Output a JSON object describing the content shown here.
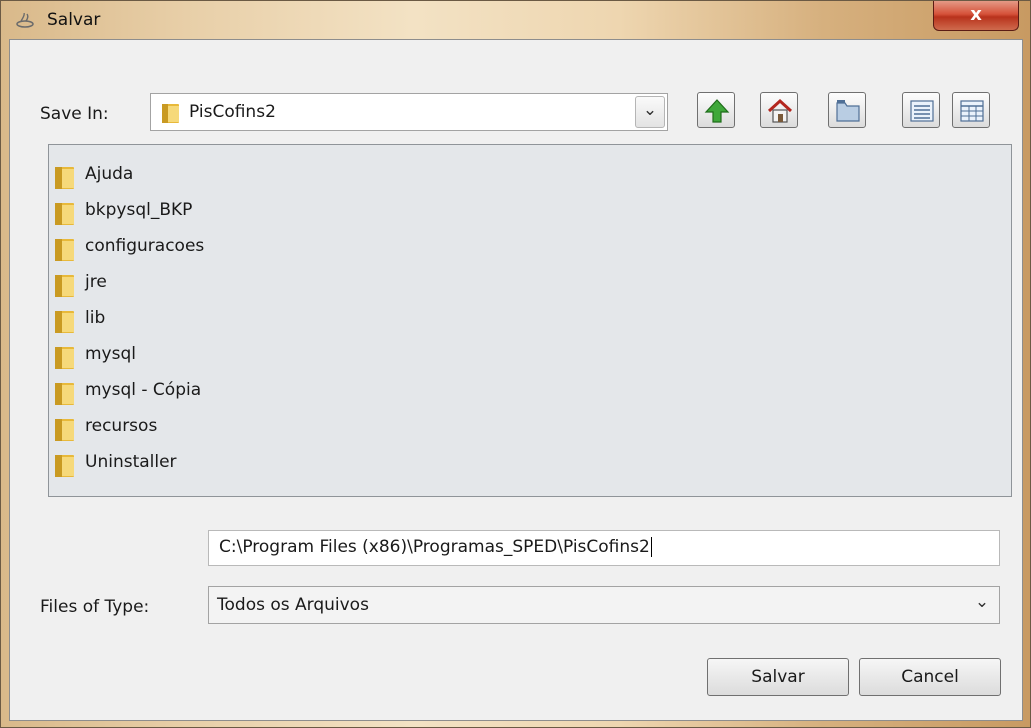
{
  "window": {
    "title": "Salvar",
    "close_glyph": "x"
  },
  "save_in": {
    "label": "Save In:",
    "value": "PisCofins2",
    "arrow_glyph": "⌄"
  },
  "toolbar": [
    {
      "name": "up-one-level-button",
      "icon": "green-up-arrow-icon"
    },
    {
      "name": "home-button",
      "icon": "home-icon"
    },
    {
      "name": "new-folder-button",
      "icon": "new-folder-icon"
    },
    {
      "name": "list-view-button",
      "icon": "list-view-icon"
    },
    {
      "name": "details-view-button",
      "icon": "details-view-icon"
    }
  ],
  "files": [
    "Ajuda",
    "bkpysql_BKP",
    "configuracoes",
    "jre",
    "lib",
    "mysql",
    "mysql - Cópia",
    "recursos",
    "Uninstaller"
  ],
  "file_name": {
    "value": "C:\\Program Files (x86)\\Programas_SPED\\PisCofins2"
  },
  "files_of_type": {
    "label": "Files of Type:",
    "value": "Todos os Arquivos",
    "arrow_glyph": "⌄"
  },
  "buttons": {
    "save_label": "Salvar",
    "cancel_label": "Cancel"
  },
  "colors": {
    "folder": "#e8b93a",
    "close": "#c9462d",
    "up_arrow": "#3fa83a"
  }
}
